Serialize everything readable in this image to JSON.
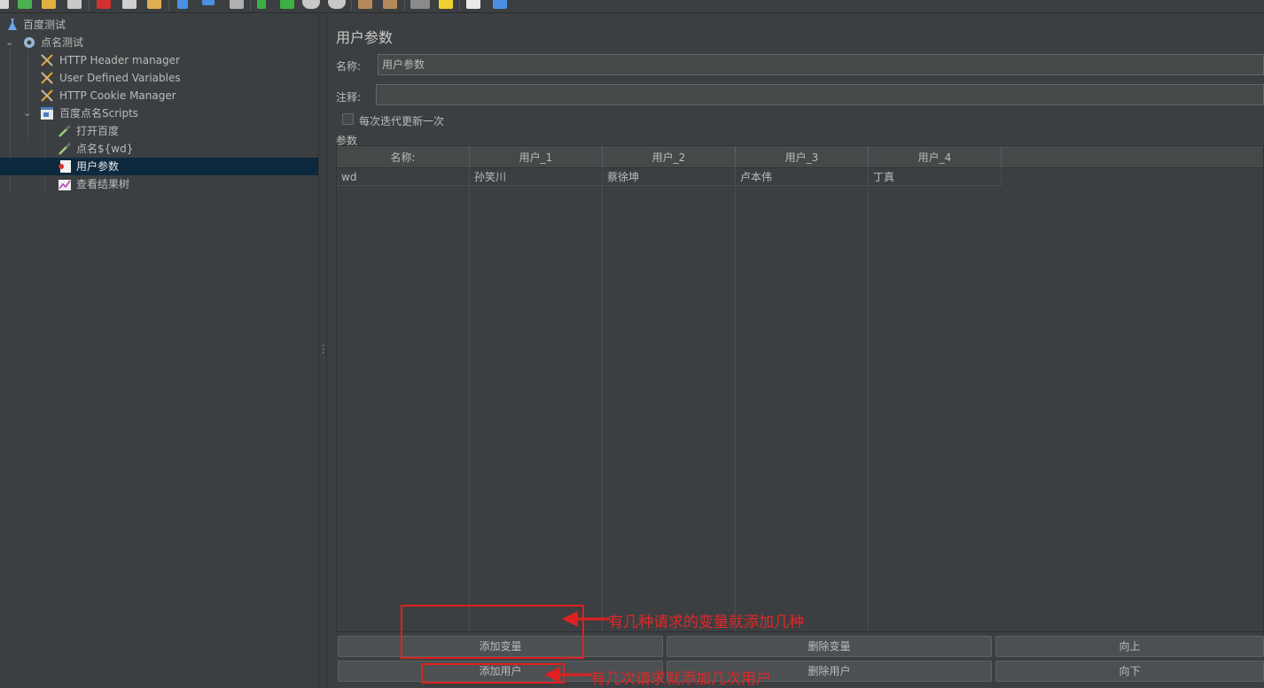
{
  "toolbar": {
    "icons": [
      "new-icon",
      "templates-icon",
      "open-icon",
      "save-icon",
      "cut-icon",
      "copy-icon",
      "paste-icon",
      "expand-icon",
      "collapse-icon",
      "toggle-icon",
      "start-icon",
      "start-no-pause-icon",
      "stop-icon",
      "shutdown-icon",
      "clear-icon",
      "clear-all-icon",
      "search-icon",
      "reset-search-icon",
      "function-helper-icon",
      "help-icon"
    ]
  },
  "tree": {
    "items": [
      {
        "label": "百度测试",
        "icon": "test-plan-icon"
      },
      {
        "label": "点名测试",
        "icon": "thread-group-gear-icon"
      },
      {
        "label": "HTTP Header manager",
        "icon": "config-wrench-icon"
      },
      {
        "label": "User Defined Variables",
        "icon": "config-wrench-icon"
      },
      {
        "label": "HTTP Cookie Manager",
        "icon": "config-wrench-icon"
      },
      {
        "label": "百度点名Scripts",
        "icon": "transaction-controller-icon"
      },
      {
        "label": "打开百度",
        "icon": "sampler-pipette-icon"
      },
      {
        "label": "点名${wd}",
        "icon": "sampler-pipette-icon"
      },
      {
        "label": "用户参数",
        "icon": "preprocessor-icon"
      },
      {
        "label": "查看结果树",
        "icon": "listener-chart-icon"
      }
    ]
  },
  "panel": {
    "title": "用户参数",
    "name_label": "名称:",
    "name_value": "用户参数",
    "comment_label": "注释:",
    "comment_value": "",
    "checkbox_label": "每次迭代更新一次",
    "params_label": "参数"
  },
  "table": {
    "headers": [
      "名称:",
      "用户_1",
      "用户_2",
      "用户_3",
      "用户_4"
    ],
    "rows": [
      [
        "wd",
        "孙笑川",
        "蔡徐坤",
        "卢本伟",
        "丁真"
      ]
    ]
  },
  "buttons": {
    "add_variable": "添加变量",
    "delete_variable": "删除变量",
    "up": "向上",
    "add_user": "添加用户",
    "delete_user": "删除用户",
    "down": "向下"
  },
  "annotations": {
    "note1": "有几种请求的变量就添加几种",
    "note2": "有几次请求就添加几次用户",
    "color": "#e32626"
  }
}
